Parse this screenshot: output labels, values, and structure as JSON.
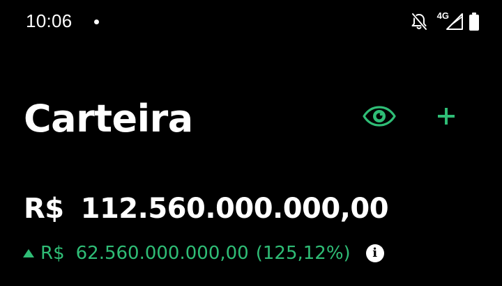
{
  "status_bar": {
    "time": "10:06",
    "network_label": "4G",
    "icons": [
      "notification-dot-icon",
      "bell-off-icon",
      "signal-icon",
      "battery-icon"
    ]
  },
  "header": {
    "title": "Carteira",
    "actions": [
      "eye-icon",
      "plus-icon"
    ]
  },
  "balance": {
    "currency": "R$",
    "amount": "112.560.000.000,00"
  },
  "change": {
    "direction": "up",
    "currency": "R$",
    "amount": "62.560.000.000,00",
    "percent": "(125,12%)",
    "info_icon": "info-icon"
  },
  "colors": {
    "background": "#000000",
    "text": "#ffffff",
    "accent": "#2fbd76"
  }
}
